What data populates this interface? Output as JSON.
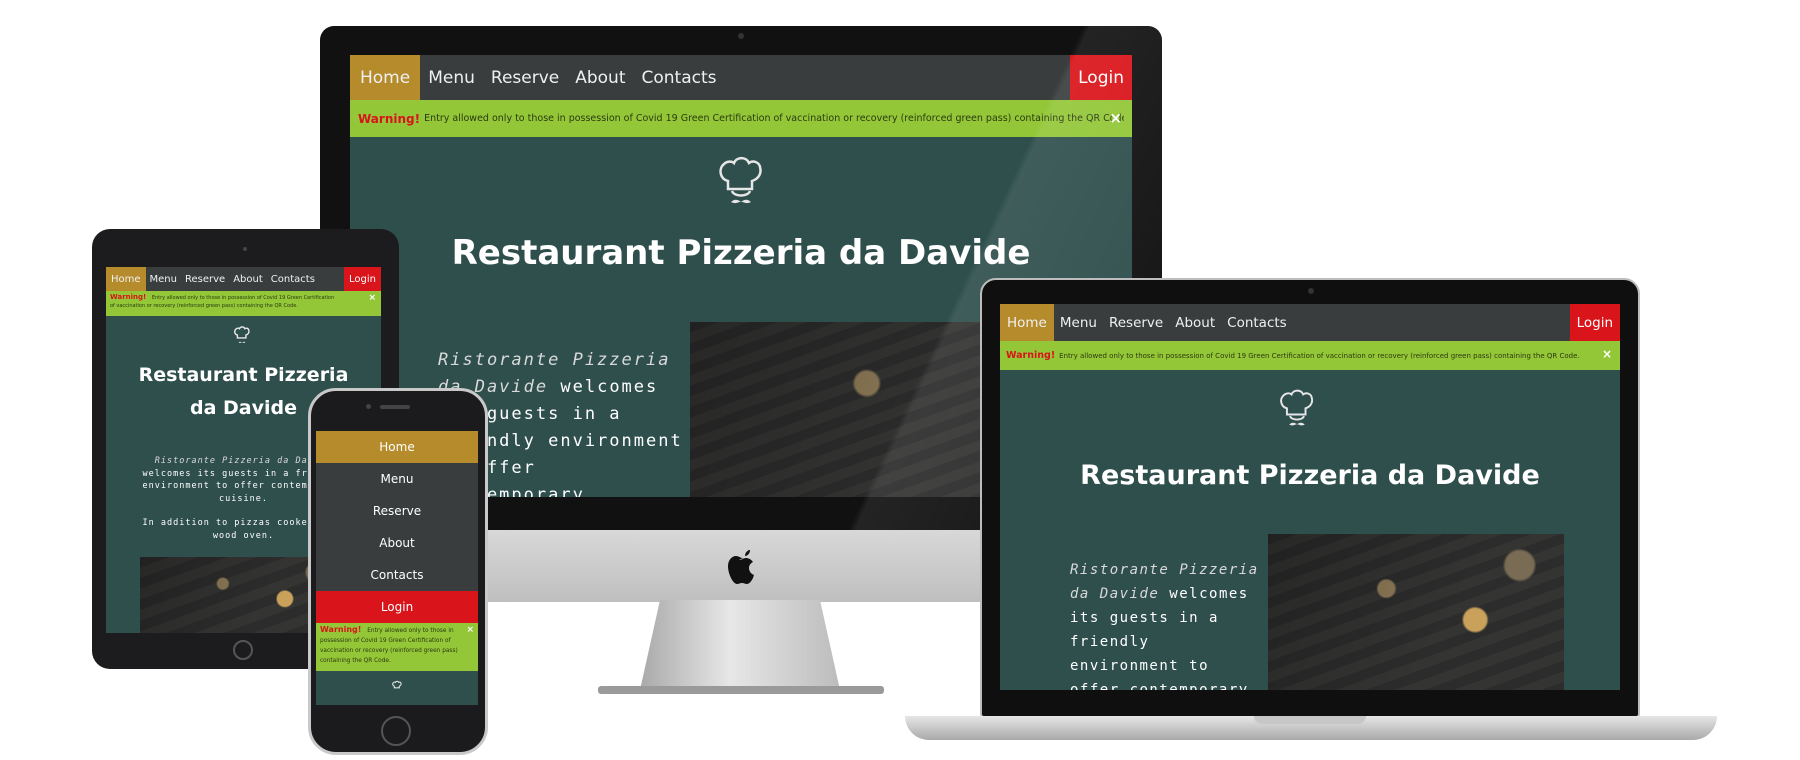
{
  "site": {
    "nav": {
      "home": "Home",
      "menu": "Menu",
      "reserve": "Reserve",
      "about": "About",
      "contacts": "Contacts",
      "login": "Login"
    },
    "warning": {
      "label": "Warning!",
      "text": "Entry allowed only to those in possession of Covid 19 Green Certification of vaccination or recovery (reinforced green pass) containing the QR Code.",
      "text_short_a": "Entry allowed only to those in possession of Covid 19 Green Certification",
      "text_short_b": "of vaccination or recovery (reinforced green pass) containing the QR Code.",
      "close": "×"
    },
    "title": "Restaurant Pizzeria da Davide",
    "title_line1": "Restaurant Pizzeria",
    "title_line2": "da Davide",
    "intro": {
      "em": "Ristorante Pizzeria da Davide",
      "rest": "welcomes its guests in a friendly environment to offer contemporary cuisine.",
      "line2": "In addition to pizzas cooked in a wood oven."
    }
  },
  "colors": {
    "nav_bg": "#393d3e",
    "active": "#b58b2c",
    "login": "#d9141a",
    "warning_bg": "#93c738",
    "page_bg": "#2f4f4d"
  },
  "icons": {
    "logo": "chef-hat-icon",
    "apple": "apple-logo-icon",
    "close": "close-icon"
  }
}
